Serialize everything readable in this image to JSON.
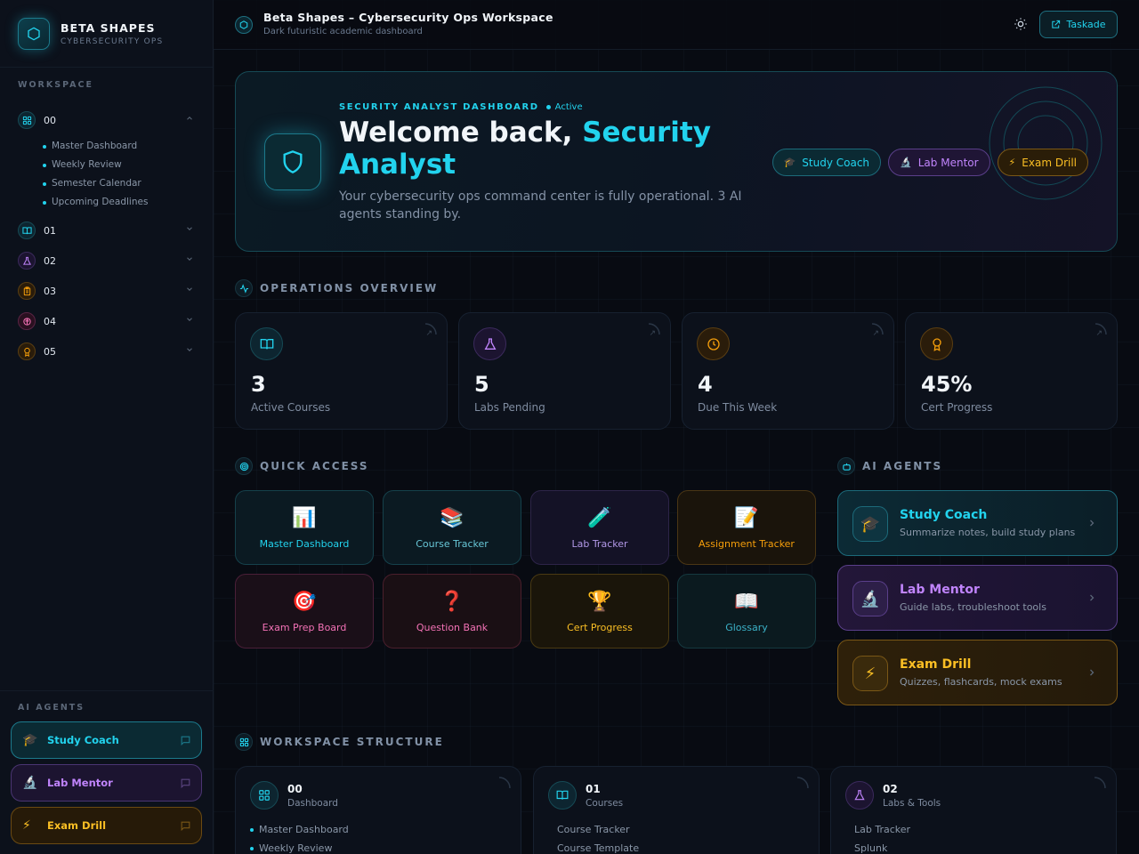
{
  "brand": {
    "title": "BETA SHAPES",
    "subtitle": "CYBERSECURITY OPS"
  },
  "sidebar": {
    "workspace_label": "WORKSPACE",
    "items": [
      {
        "num": "00",
        "icon": "grid-icon",
        "color": "#22d3ee",
        "expanded": true,
        "children": [
          "Master Dashboard",
          "Weekly Review",
          "Semester Calendar",
          "Upcoming Deadlines"
        ]
      },
      {
        "num": "01",
        "icon": "book-icon",
        "color": "#22d3ee",
        "expanded": false
      },
      {
        "num": "02",
        "icon": "flask-icon",
        "color": "#a78bfa",
        "expanded": false
      },
      {
        "num": "03",
        "icon": "clipboard-icon",
        "color": "#f59e0b",
        "expanded": false
      },
      {
        "num": "04",
        "icon": "brain-icon",
        "color": "#f472b6",
        "expanded": false
      },
      {
        "num": "05",
        "icon": "award-icon",
        "color": "#f59e0b",
        "expanded": false
      }
    ],
    "agents_label": "AI AGENTS",
    "agents": [
      {
        "label": "Study Coach",
        "emoji": "🎓",
        "color": "#22d3ee"
      },
      {
        "label": "Lab Mentor",
        "emoji": "🔬",
        "color": "#c084fc"
      },
      {
        "label": "Exam Drill",
        "emoji": "⚡",
        "color": "#fbbf24"
      }
    ]
  },
  "topbar": {
    "title": "Beta Shapes – Cybersecurity Ops Workspace",
    "subtitle": "Dark futuristic academic dashboard",
    "button_label": "Taskade"
  },
  "hero": {
    "kicker": "SECURITY ANALYST DASHBOARD",
    "status": "Active",
    "title_prefix": "Welcome back,",
    "title_accent": "Security Analyst",
    "description": "Your cybersecurity ops command center is fully operational. 3 AI agents standing by.",
    "chips": [
      {
        "label": "Study Coach",
        "emoji": "🎓"
      },
      {
        "label": "Lab Mentor",
        "emoji": "🔬"
      },
      {
        "label": "Exam Drill",
        "emoji": "⚡"
      }
    ]
  },
  "overview": {
    "label": "OPERATIONS OVERVIEW",
    "stats": [
      {
        "value": "3",
        "label": "Active Courses",
        "icon": "book-icon",
        "color": "#22d3ee"
      },
      {
        "value": "5",
        "label": "Labs Pending",
        "icon": "flask-icon",
        "color": "#c084fc"
      },
      {
        "value": "4",
        "label": "Due This Week",
        "icon": "clock-icon",
        "color": "#f59e0b"
      },
      {
        "value": "45%",
        "label": "Cert Progress",
        "icon": "award-icon",
        "color": "#f59e0b"
      }
    ]
  },
  "quick_access": {
    "label": "QUICK ACCESS",
    "tiles": [
      {
        "label": "Master Dashboard",
        "emoji": "📊",
        "color": "#22d3ee"
      },
      {
        "label": "Course Tracker",
        "emoji": "📚",
        "color": "#22d3ee"
      },
      {
        "label": "Lab Tracker",
        "emoji": "🧪",
        "color": "#c084fc"
      },
      {
        "label": "Assignment Tracker",
        "emoji": "📝",
        "color": "#f59e0b"
      },
      {
        "label": "Exam Prep Board",
        "emoji": "🎯",
        "color": "#f472b6"
      },
      {
        "label": "Question Bank",
        "emoji": "❓",
        "color": "#f472b6"
      },
      {
        "label": "Cert Progress",
        "emoji": "🏆",
        "color": "#fbbf24"
      },
      {
        "label": "Glossary",
        "emoji": "📖",
        "color": "#22d3ee"
      }
    ]
  },
  "ai_agents": {
    "label": "AI AGENTS",
    "cards": [
      {
        "name": "Study Coach",
        "desc": "Summarize notes, build study plans",
        "emoji": "🎓",
        "color": "#22d3ee"
      },
      {
        "name": "Lab Mentor",
        "desc": "Guide labs, troubleshoot tools",
        "emoji": "🔬",
        "color": "#c084fc"
      },
      {
        "name": "Exam Drill",
        "desc": "Quizzes, flashcards, mock exams",
        "emoji": "⚡",
        "color": "#fbbf24"
      }
    ]
  },
  "structure": {
    "label": "WORKSPACE STRUCTURE",
    "cards": [
      {
        "num": "00",
        "name": "Dashboard",
        "icon": "grid-icon",
        "color": "#22d3ee",
        "dotted": true,
        "items": [
          "Master Dashboard",
          "Weekly Review"
        ]
      },
      {
        "num": "01",
        "name": "Courses",
        "icon": "book-icon",
        "color": "#22d3ee",
        "dotted": false,
        "items": [
          "Course Tracker",
          "Course Template"
        ]
      },
      {
        "num": "02",
        "name": "Labs & Tools",
        "icon": "flask-icon",
        "color": "#c084fc",
        "dotted": false,
        "items": [
          "Lab Tracker",
          "Splunk"
        ]
      }
    ]
  }
}
